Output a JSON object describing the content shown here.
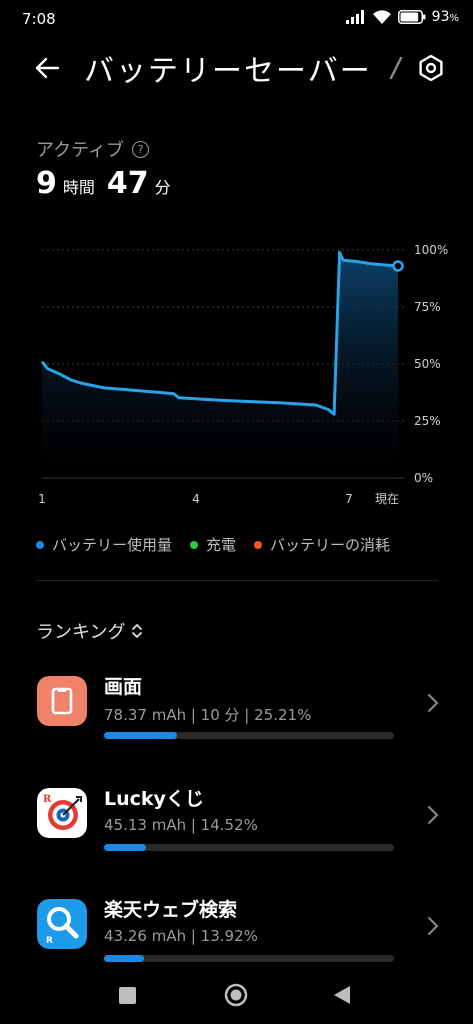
{
  "status_bar": {
    "time": "7:08",
    "battery_percent": "93",
    "battery_level": 0.93,
    "icons": [
      "signal-icon",
      "wifi-icon",
      "battery-icon"
    ]
  },
  "header": {
    "title": "バッテリーセーバー"
  },
  "active": {
    "label": "アクティブ",
    "hours": "9",
    "hours_unit": "時間",
    "minutes": "47",
    "minutes_unit": "分"
  },
  "chart_data": {
    "type": "area",
    "y_ticks": [
      "100%",
      "75%",
      "50%",
      "25%",
      "0%"
    ],
    "x_ticks": [
      "1",
      "4",
      "7",
      "現在"
    ],
    "ylim": [
      0,
      100
    ],
    "xlim": [
      0,
      9.75
    ],
    "series": [
      {
        "name": "バッテリー使用量",
        "x": [
          0,
          0.15,
          0.5,
          0.8,
          1.1,
          1.7,
          2.5,
          3.6,
          3.75,
          5.0,
          6.5,
          7.5,
          7.85,
          8.0,
          8.15,
          8.25,
          8.6,
          9.0,
          9.75
        ],
        "values": [
          51,
          48,
          45.5,
          43,
          41.5,
          39.5,
          38.5,
          37,
          35.2,
          34,
          33,
          32,
          30,
          28,
          99,
          95.5,
          95,
          94,
          93
        ]
      }
    ],
    "grid": true,
    "colors": {
      "line": "#29a3e8",
      "area": "#0d3a5c"
    }
  },
  "legend": [
    {
      "label": "バッテリー使用量",
      "color": "#1e88e5"
    },
    {
      "label": "充電",
      "color": "#2ecc40"
    },
    {
      "label": "バッテリーの消耗",
      "color": "#ff5722"
    }
  ],
  "ranking": {
    "title": "ランキング",
    "items": [
      {
        "name": "画面",
        "detail": "78.37 mAh | 10 分  | 25.21%",
        "share": 0.2521,
        "icon": "screen-icon"
      },
      {
        "name": "Luckyくじ",
        "detail": "45.13 mAh | 14.52%",
        "share": 0.1452,
        "icon": "lucky-kuji-app-icon"
      },
      {
        "name": "楽天ウェブ検索",
        "detail": "43.26 mAh | 13.92%",
        "share": 0.1392,
        "icon": "rakuten-web-search-app-icon"
      }
    ]
  },
  "nav": {
    "icons": [
      "recents-icon",
      "home-icon",
      "back-icon"
    ]
  }
}
